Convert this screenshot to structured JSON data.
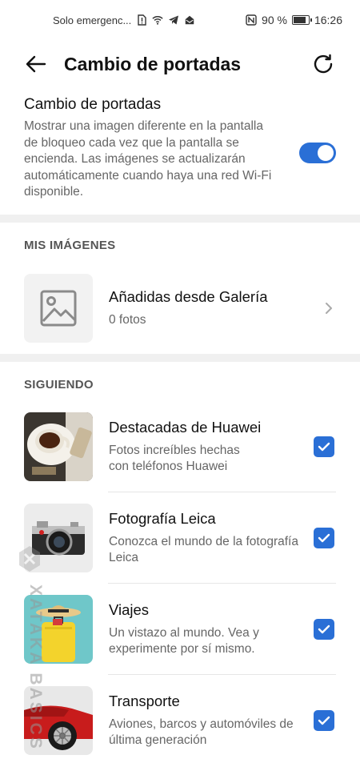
{
  "status_bar": {
    "carrier_text": "Solo emergenc...",
    "battery_text": "90 %",
    "battery_level": 0.9,
    "time": "16:26",
    "icons": [
      "alert-sim-icon",
      "wifi-icon",
      "telegram-icon",
      "mail-icon",
      "nfc-icon",
      "battery-icon"
    ]
  },
  "app_bar": {
    "title": "Cambio de portadas",
    "back_icon": "arrow-left-icon",
    "refresh_icon": "refresh-icon"
  },
  "toggle": {
    "title": "Cambio de portadas",
    "description": "Mostrar una imagen diferente en la pantalla de bloqueo cada vez que la pantalla se encienda. Las imágenes se actualizarán automáticamente cuando haya una red Wi-Fi disponible.",
    "enabled": true
  },
  "my_images": {
    "header": "MIS IMÁGENES",
    "gallery": {
      "title": "Añadidas desde Galería",
      "count": "0 fotos"
    }
  },
  "following": {
    "header": "SIGUIENDO",
    "items": [
      {
        "title": "Destacadas de Huawei",
        "subtitle": "Fotos increíbles hechas\n con teléfonos Huawei",
        "checked": true
      },
      {
        "title": "Fotografía Leica",
        "subtitle": "Conozca el mundo de la fotografía Leica",
        "checked": true
      },
      {
        "title": "Viajes",
        "subtitle": "Un vistazo al mundo. Vea y experimente por sí mismo.",
        "checked": true
      },
      {
        "title": "Transporte",
        "subtitle": "Aviones, barcos y automóviles de última generación",
        "checked": true
      }
    ]
  },
  "watermark": {
    "text": "XATAKA BASICS"
  },
  "colors": {
    "accent": "#2a6fd6",
    "section_band": "#f0f0f0"
  }
}
